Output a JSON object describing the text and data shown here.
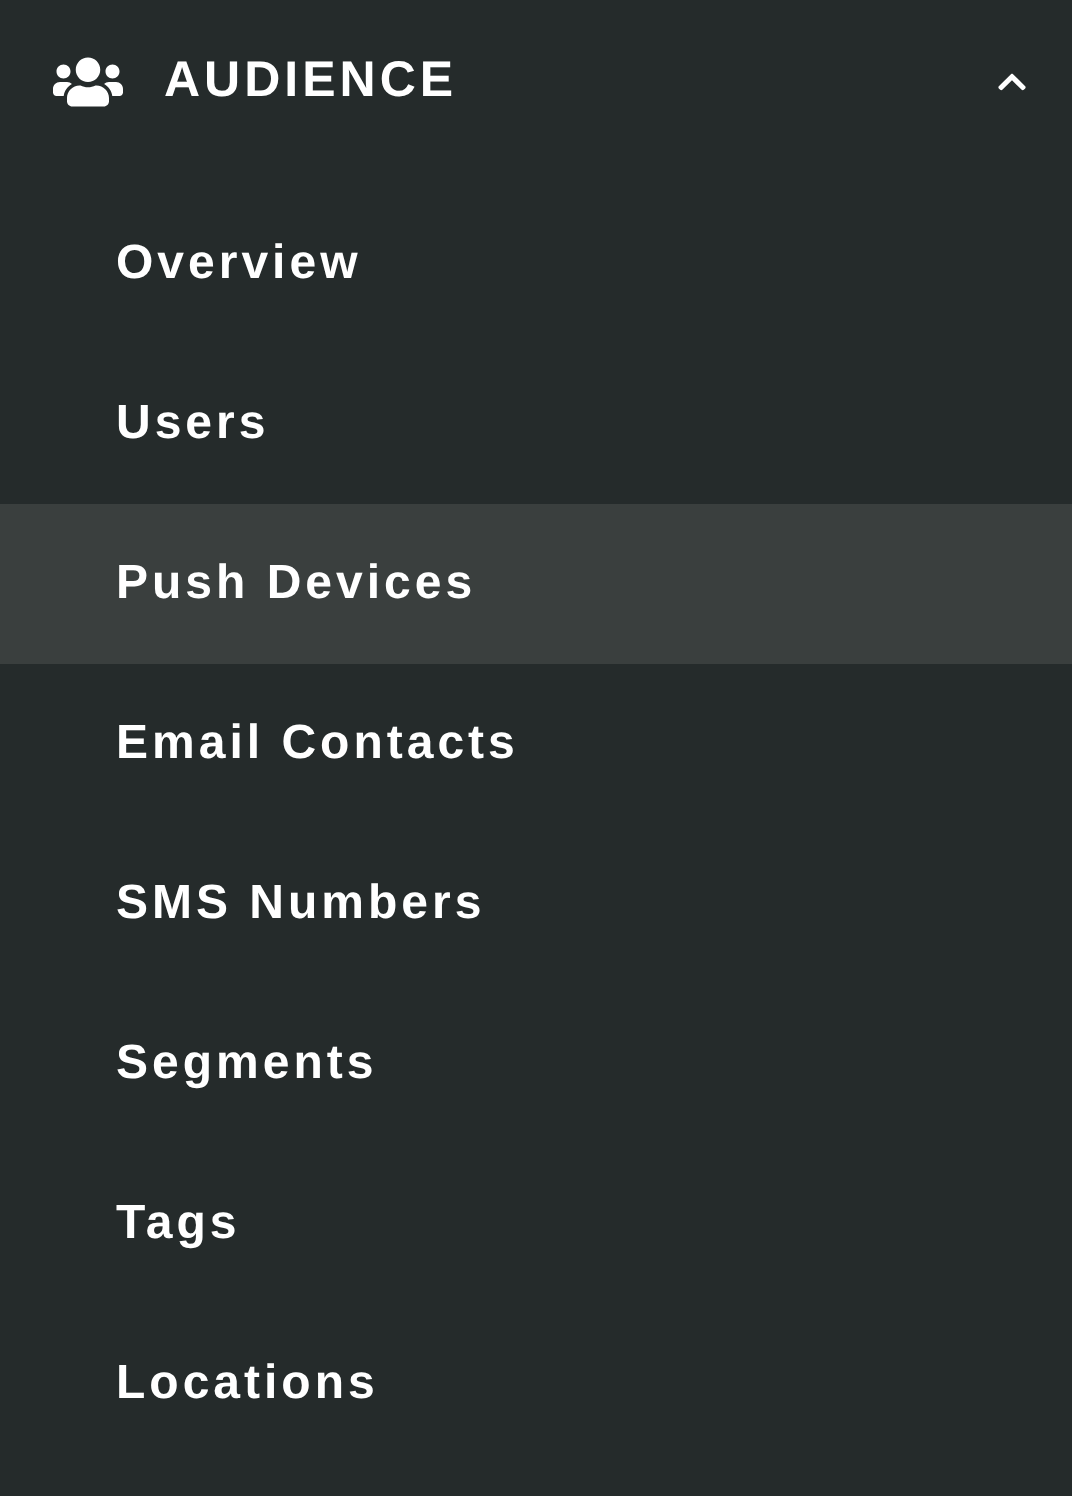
{
  "section": {
    "title": "AUDIENCE",
    "expanded": true
  },
  "items": [
    {
      "label": "Overview",
      "selected": false
    },
    {
      "label": "Users",
      "selected": false
    },
    {
      "label": "Push Devices",
      "selected": true
    },
    {
      "label": "Email Contacts",
      "selected": false
    },
    {
      "label": "SMS Numbers",
      "selected": false
    },
    {
      "label": "Segments",
      "selected": false
    },
    {
      "label": "Tags",
      "selected": false
    },
    {
      "label": "Locations",
      "selected": false
    }
  ]
}
